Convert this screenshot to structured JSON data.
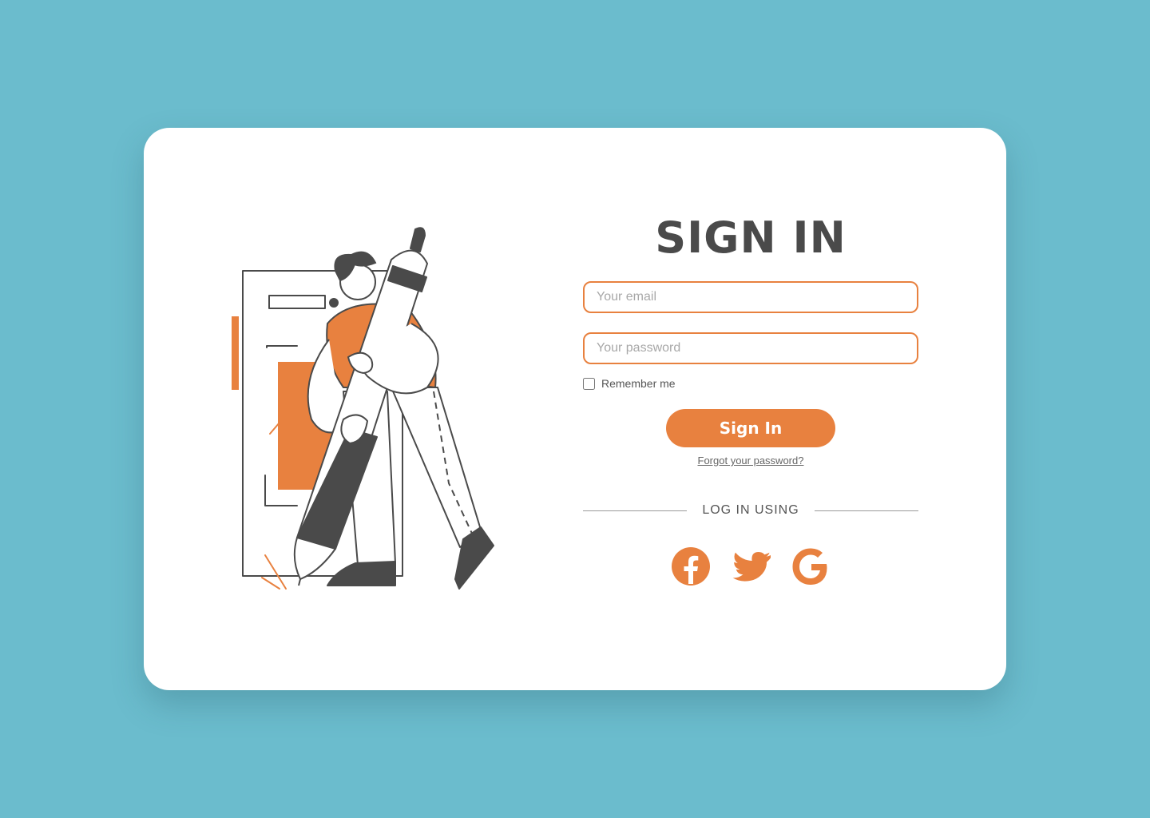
{
  "form": {
    "title": "SIGN IN",
    "email_placeholder": "Your email",
    "password_placeholder": "Your password",
    "remember_label": "Remember me",
    "submit_label": "Sign In",
    "forgot_label": "Forgot your password?",
    "divider_label": "LOG IN USING"
  },
  "social": [
    {
      "icon": "facebook-icon"
    },
    {
      "icon": "twitter-icon"
    },
    {
      "icon": "google-icon"
    }
  ],
  "colors": {
    "background": "#6bbccd",
    "card": "#ffffff",
    "accent": "#e8813f",
    "text_dark": "#4a4a4a"
  }
}
